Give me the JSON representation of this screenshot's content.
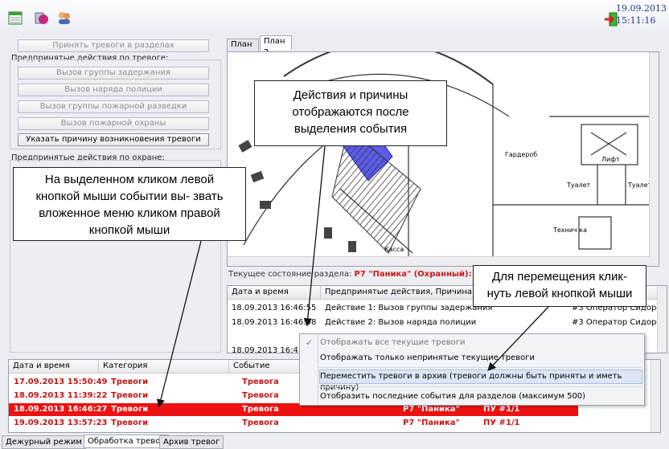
{
  "toolbar": {
    "icons": [
      "calendar-icon",
      "alarm-sphere-icon",
      "users-icon"
    ],
    "exit_icon": "exit-door-icon",
    "date": "19.09.2013",
    "time": "15:11:16"
  },
  "left": {
    "accept_button": "Принять тревоги в разделах",
    "group1_title": "Предпринятые действия по тревоге:",
    "group1_buttons": [
      "Вызов группы задержания",
      "Вызов наряда полиции",
      "Вызов группы пожарной разведки",
      "Вызов пожарной охраны",
      "Указать причину возникновения тревоги"
    ],
    "group2_title": "Предпринятые действия по охране:"
  },
  "plan": {
    "tabs": [
      "План 1",
      "План 2"
    ],
    "labels": {
      "wardrobe": "Гардероб",
      "lift": "Лифт",
      "toilet1": "Туалет",
      "toilet2": "Туалет",
      "tech": "Технич ка",
      "cash": "Касса"
    }
  },
  "status": {
    "label": "Текущее состояние раздела:",
    "value": "P7 \"Паника\" (Охранный): Т"
  },
  "events": {
    "headers": [
      "Дата и время",
      "Предпринятые действия, Причина т"
    ],
    "rows": [
      {
        "time": "18.09.2013 16:46:55",
        "action": "Действие 1: Вызов группы задержания",
        "operator": "#3 Оператор Сидоров"
      },
      {
        "time": "18.09.2013 16:46:58",
        "action": "Действие 2: Вызов наряда полиции",
        "operator": "#3 Оператор Сидоров"
      },
      {
        "time": "18.09.2013 16:47",
        "action": "",
        "operator": ""
      }
    ]
  },
  "context_menu": {
    "items": [
      "Отображать все текущие тревоги",
      "Отображать только непринятые текущие тревоги",
      "Переместить тревоги в архив (тревоги должны быть приняты и иметь причину)",
      "Отобразить последние события для разделов (максимум 500)"
    ]
  },
  "alarms": {
    "headers": [
      "Дата и время",
      "Категория",
      "Событие"
    ],
    "rows": [
      {
        "time": "17.09.2013 15:50:49",
        "category": "Тревоги",
        "event": "Тревога",
        "zone": "",
        "device": ""
      },
      {
        "time": "18.09.2013 11:39:22",
        "category": "Тревоги",
        "event": "Тревога",
        "zone": "",
        "device": ""
      },
      {
        "time": "18.09.2013 16:46:27",
        "category": "Тревоги",
        "event": "Тревога",
        "zone": "P7 \"Паника\"",
        "device": "ПУ #1/1"
      },
      {
        "time": "19.09.2013 13:57:23",
        "category": "Тревоги",
        "event": "Тревога",
        "zone": "P7 \"Паника\"",
        "device": "ПУ #1/1"
      }
    ]
  },
  "bottom_tabs": [
    "Дежурный режим",
    "Обработка тревог",
    "Архив тревог"
  ],
  "callouts": {
    "c1": "Действия и причины отображаются после выделения события",
    "c2": "На выделенном кликом левой кнопкой мыши событии вы- звать вложенное меню кликом правой кнопкой мыши",
    "c3": "Для перемещения клик- нуть левой кнопкой мыши"
  }
}
